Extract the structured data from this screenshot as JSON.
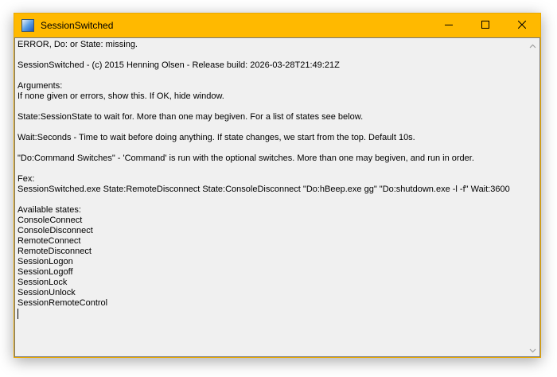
{
  "window": {
    "title": "SessionSwitched",
    "titlebar_color": "#ffb900"
  },
  "caption_buttons": {
    "minimize_icon": "minimize-icon",
    "maximize_icon": "maximize-icon",
    "close_icon": "close-icon"
  },
  "output": {
    "lines": [
      "ERROR, Do: or State: missing.",
      "",
      "SessionSwitched - (c) 2015 Henning Olsen - Release build: 2026-03-28T21:49:21Z",
      "",
      "Arguments:",
      "If none given or errors, show this. If OK, hide window.",
      "",
      "State:SessionState to wait for. More than one may begiven. For a list of states see below.",
      "",
      "Wait:Seconds - Time to wait before doing anything. If state changes, we start from the top. Default 10s.",
      "",
      "\"Do:Command Switches\" - 'Command' is run with the optional switches. More than one may begiven, and run in order.",
      "",
      "Fex:",
      "SessionSwitched.exe State:RemoteDisconnect State:ConsoleDisconnect \"Do:hBeep.exe gg\" \"Do:shutdown.exe -l -f\" Wait:3600",
      "",
      "Available states:",
      "ConsoleConnect",
      "ConsoleDisconnect",
      "RemoteConnect",
      "RemoteDisconnect",
      "SessionLogon",
      "SessionLogoff",
      "SessionLock",
      "SessionUnlock",
      "SessionRemoteControl"
    ]
  }
}
